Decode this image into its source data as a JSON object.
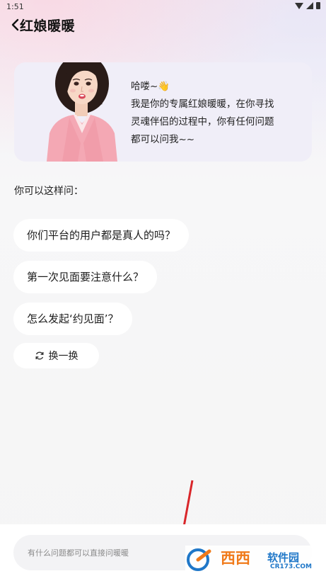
{
  "status_bar": {
    "time": "1:51"
  },
  "header": {
    "title": "红娘暖暖"
  },
  "intro": {
    "greeting": "哈喽~👋",
    "line1": "我是你的专属红娘暖暖，在你寻找",
    "line2": "灵魂伴侣的过程中，你有任何问题",
    "line3": "都可以问我~~"
  },
  "prompt_label": "你可以这样问：",
  "suggestions": [
    "你们平台的用户都是真人的吗？",
    "第一次见面要注意什么？",
    "怎么发起‘约见面’？"
  ],
  "refresh_label": "换一换",
  "input": {
    "placeholder": "有什么问题都可以直接问暖暖"
  },
  "watermark": {
    "brand": "西西",
    "suffix": "软件园",
    "url": "CR173.COM"
  },
  "colors": {
    "accent_red": "#d9262a",
    "watermark_orange": "#f07a1a",
    "watermark_blue": "#1f77c8"
  }
}
